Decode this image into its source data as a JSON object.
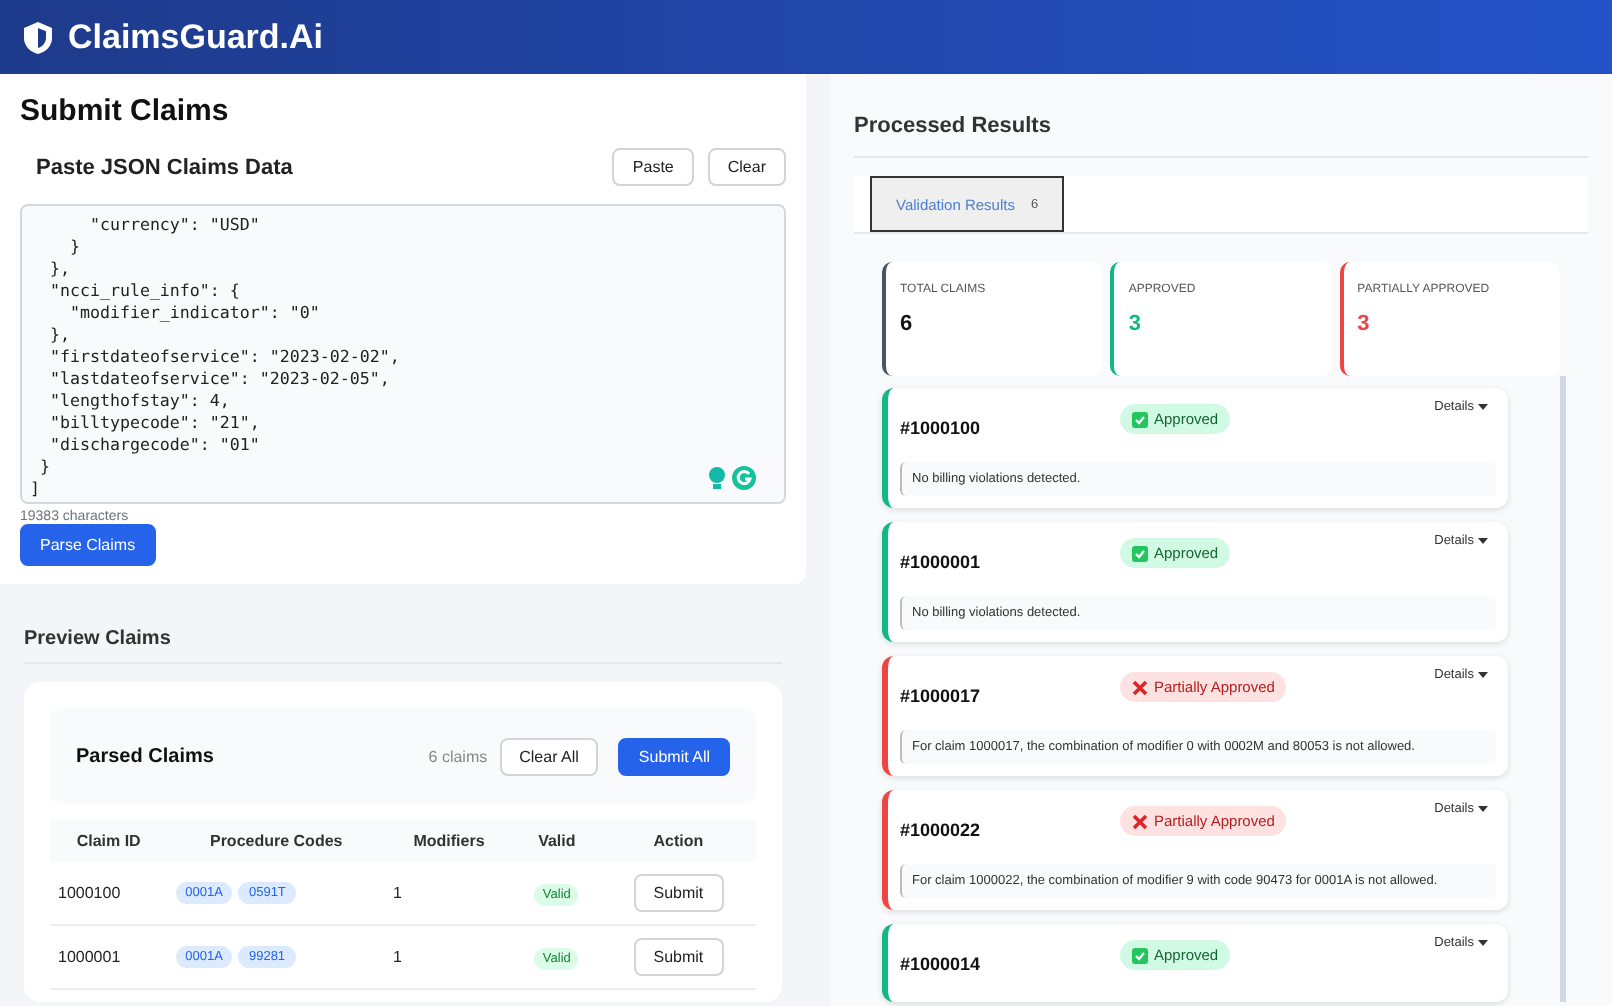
{
  "app": {
    "title": "ClaimsGuard.Ai"
  },
  "submit": {
    "title": "Submit Claims",
    "subtitle": "Paste JSON Claims Data",
    "buttons": [
      "Paste",
      "Clear"
    ],
    "json_lines": [
      "      \"currency\": \"USD\"",
      "    }",
      "  },",
      "  \"ncci_rule_info\": {",
      "    \"modifier_indicator\": \"0\"",
      "  },",
      "  \"firstdateofservice\": \"2023-02-02\",",
      "  \"lastdateofservice\": \"2023-02-05\",",
      "  \"lengthofstay\": 4,",
      "  \"billtypecode\": \"21\",",
      "  \"dischargecode\": \"01\"",
      " }",
      "]"
    ],
    "char_count": "19383 characters",
    "parse_button": "Parse Claims"
  },
  "preview": {
    "title": "Preview Claims",
    "card_title": "Parsed Claims",
    "count": "6 claims",
    "clear_button": "Clear All",
    "submit_button": "Submit All",
    "columns": [
      "Claim ID",
      "Procedure Codes",
      "Modifiers",
      "Valid",
      "Action"
    ],
    "rows": [
      {
        "claim_id": "1000100",
        "codes": [
          "0001A",
          "0591T"
        ],
        "modifiers": "1",
        "valid": "Valid",
        "action": "Submit"
      },
      {
        "claim_id": "1000001",
        "codes": [
          "0001A",
          "99281"
        ],
        "modifiers": "1",
        "valid": "Valid",
        "action": "Submit"
      }
    ]
  },
  "results": {
    "title": "Processed Results",
    "tabs": [
      {
        "label": "Validation Results",
        "count": "6",
        "selected": true
      }
    ],
    "stats": [
      {
        "label": "TOTAL CLAIMS",
        "value": "6",
        "color": "#4b5563"
      },
      {
        "label": "APPROVED",
        "value": "3",
        "color": "#10b981"
      },
      {
        "label": "PARTIALLY APPROVED",
        "value": "3",
        "color": "#ef4444"
      }
    ],
    "claims": [
      {
        "id": "#1000100",
        "status": "Approved",
        "kind": "approved",
        "details": "Details",
        "message": "No billing violations detected."
      },
      {
        "id": "#1000001",
        "status": "Approved",
        "kind": "approved",
        "details": "Details",
        "message": "No billing violations detected."
      },
      {
        "id": "#1000017",
        "status": "Partially Approved",
        "kind": "partial",
        "details": "Details",
        "message": "For claim 1000017, the combination of modifier 0 with 0002M and 80053 is not allowed."
      },
      {
        "id": "#1000022",
        "status": "Partially Approved",
        "kind": "partial",
        "details": "Details",
        "message": "For claim 1000022, the combination of modifier 9 with code 90473 for 0001A is not allowed."
      },
      {
        "id": "#1000014",
        "status": "Approved",
        "kind": "approved",
        "details": "Details"
      }
    ]
  }
}
